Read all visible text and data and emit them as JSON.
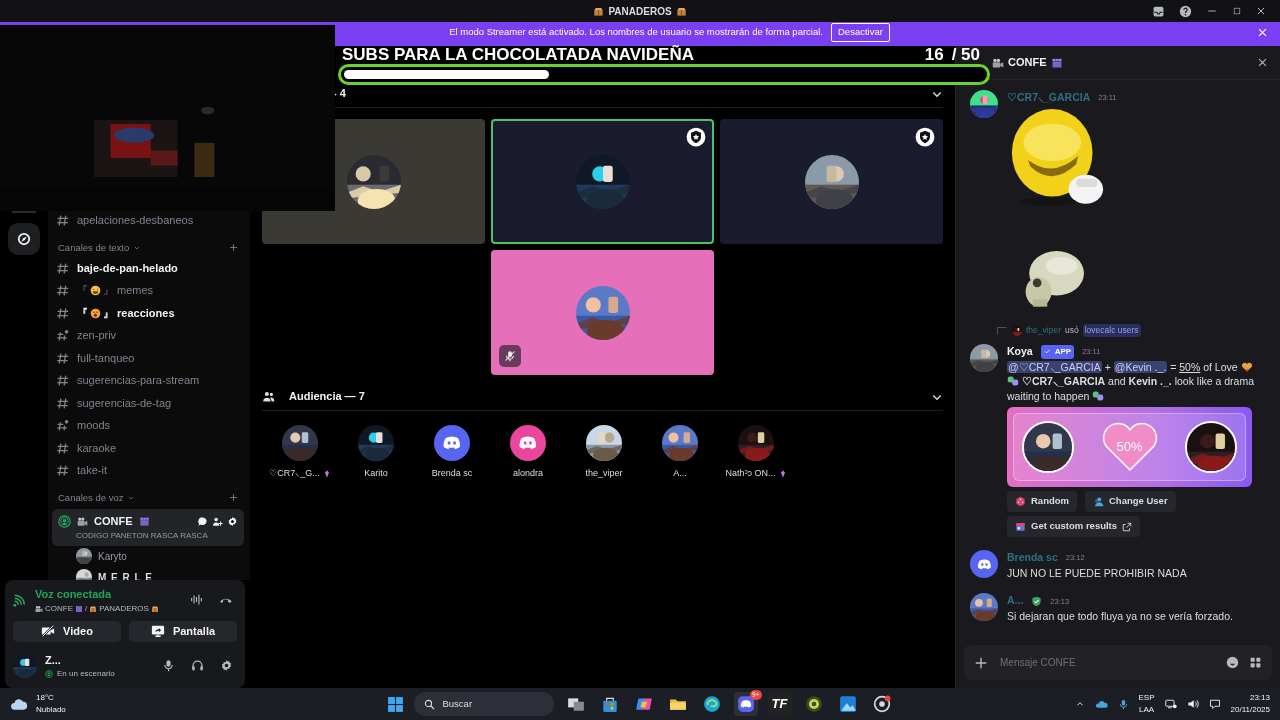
{
  "window": {
    "title": "PANADEROS"
  },
  "streamer_banner": {
    "text": "El modo Streamer está activado. Los nombres de usuario se mostrarán de forma parcial.",
    "button": "Desactivar"
  },
  "goal_overlay": {
    "title": "SUBS PARA LA CHOCOLATADA NAVIDEÑA",
    "count": "16",
    "total": "/ 50",
    "level": 0.32
  },
  "sidebar": {
    "top_channels": [
      {
        "name": "apelaciones-desbaneos",
        "unread": false,
        "kind": "public"
      }
    ],
    "text_category": "Canales de texto",
    "text_channels": [
      {
        "name": "baje-de-pan-helado",
        "unread": true,
        "kind": "public"
      },
      {
        "name": "memes",
        "unread": false,
        "kind": "public",
        "tag_open": "『",
        "tag_close": "』"
      },
      {
        "name": "reacciones",
        "unread": true,
        "kind": "public",
        "tag_open": "『",
        "tag_close": "』"
      },
      {
        "name": "zen-priv",
        "unread": false,
        "kind": "private"
      },
      {
        "name": "full-tanqueo",
        "unread": false,
        "kind": "public"
      },
      {
        "name": "sugerencias-para-stream",
        "unread": false,
        "kind": "public"
      },
      {
        "name": "sugerencias-de-tag",
        "unread": false,
        "kind": "public"
      },
      {
        "name": "moods",
        "unread": false,
        "kind": "private"
      },
      {
        "name": "karaoke",
        "unread": false,
        "kind": "public"
      },
      {
        "name": "take-it",
        "unread": false,
        "kind": "public"
      }
    ],
    "voice_category": "Canales de voz",
    "voice_channel": {
      "name": "CONFE",
      "topic": "CODIGO PANETON RASCA RASCA",
      "selected": true,
      "members": [
        "Karyto",
        "M E R L E"
      ]
    }
  },
  "voice_panel": {
    "status": "Voz conectada",
    "channel": "CONFE",
    "separator": "/",
    "server": "PANADEROS",
    "buttons": [
      {
        "label": "Video",
        "kind": "video"
      },
      {
        "label": "Pantalla",
        "kind": "screen"
      }
    ]
  },
  "user": {
    "name": "Z...",
    "status": "En un escenario"
  },
  "stage": {
    "speakers_header": "- 4",
    "speakers": [
      {
        "color": "#3a3934",
        "speaking": false,
        "moderator": false,
        "muted": false
      },
      {
        "color": "#1a1b2e",
        "speaking": true,
        "moderator": true,
        "muted": false
      },
      {
        "color": "#1a1b2e",
        "speaking": false,
        "moderator": true,
        "muted": false
      },
      {
        "color": "#e56fb8",
        "speaking": false,
        "moderator": false,
        "muted": true
      }
    ],
    "audience_header": "Audiencia — 7",
    "audience": [
      {
        "name": "♡CR7⸜_G...",
        "boosting": true,
        "avatar": {
          "kind": "picture"
        }
      },
      {
        "name": "Karito",
        "boosting": false,
        "avatar": {
          "kind": "picture"
        }
      },
      {
        "name": "Brenda sc",
        "boosting": false,
        "avatar": {
          "kind": "default",
          "color": "#5865f2"
        }
      },
      {
        "name": "alondra",
        "boosting": false,
        "avatar": {
          "kind": "default",
          "color": "#eb459e"
        }
      },
      {
        "name": "the_viper",
        "boosting": false,
        "avatar": {
          "kind": "picture"
        }
      },
      {
        "name": "A...",
        "boosting": false,
        "avatar": {
          "kind": "picture"
        }
      },
      {
        "name": "Nathᵓↄ ON...",
        "boosting": true,
        "avatar": {
          "kind": "picture"
        }
      }
    ]
  },
  "chat": {
    "title": "CONFE",
    "messages": [
      {
        "kind": "stickers",
        "author": "♡CR7⸜_GARCIA",
        "time": "23:11",
        "avatar": {
          "kind": "picture"
        },
        "stickers": [
          {
            "kind": "picture"
          },
          {
            "kind": "picture"
          }
        ]
      },
      {
        "kind": "app",
        "reply": {
          "user": "the_viper",
          "verb": "usó",
          "command": "lovecalc users"
        },
        "author": "Koya",
        "badge": "APP",
        "time": "23:11",
        "avatar": {
          "kind": "picture"
        },
        "lines": [
          [
            {
              "kind": "mention",
              "text": "@♡CR7⸜_GARCIA"
            },
            {
              "kind": "text",
              "text": "+"
            },
            {
              "kind": "mention",
              "text": "@Kevin ._."
            },
            {
              "kind": "text",
              "text": "="
            },
            {
              "kind": "link",
              "text": "50%"
            },
            {
              "kind": "text",
              "text": "of Love"
            },
            {
              "kind": "heart"
            }
          ],
          [
            {
              "kind": "masks"
            },
            {
              "kind": "text",
              "text": "**♡CR7⸜_GARCIA** and **Kevin ._.** look like a drama"
            }
          ],
          [
            {
              "kind": "text",
              "text": "waiting to happen"
            },
            {
              "kind": "masks"
            }
          ]
        ],
        "embed": {
          "percent": "50%"
        },
        "buttons": [
          {
            "label": "Random",
            "kind": "dice"
          },
          {
            "label": "Change User",
            "kind": "user"
          },
          {
            "label": "Get custom results",
            "kind": "external"
          }
        ]
      },
      {
        "kind": "text",
        "author": "Brenda sc",
        "time": "23:12",
        "avatar": {
          "kind": "default",
          "color": "#5865f2"
        },
        "text": "JUN NO LE PUEDE PROHIBIR NADA"
      },
      {
        "kind": "text",
        "author": "A...",
        "time": "23:13",
        "author_icon": true,
        "avatar": {
          "kind": "picture"
        },
        "text": "Si dejaran que todo fluya ya no se vería forzado."
      }
    ],
    "input": {
      "placeholder": "Mensaje CONFE"
    }
  },
  "taskbar": {
    "temperature": "18°C",
    "weather": "Nublado",
    "search": "Buscar",
    "apps": [
      {
        "kind": "taskview"
      },
      {
        "kind": "store"
      },
      {
        "kind": "copilot"
      },
      {
        "kind": "folder"
      },
      {
        "kind": "browser"
      },
      {
        "kind": "chat",
        "badge": "9+"
      },
      {
        "kind": "letters",
        "label": "TF"
      },
      {
        "kind": "disc"
      },
      {
        "kind": "photos"
      },
      {
        "kind": "round"
      }
    ],
    "language": "ESP",
    "layout": "LAA",
    "time": "23:13",
    "date": "20/11/2025"
  }
}
